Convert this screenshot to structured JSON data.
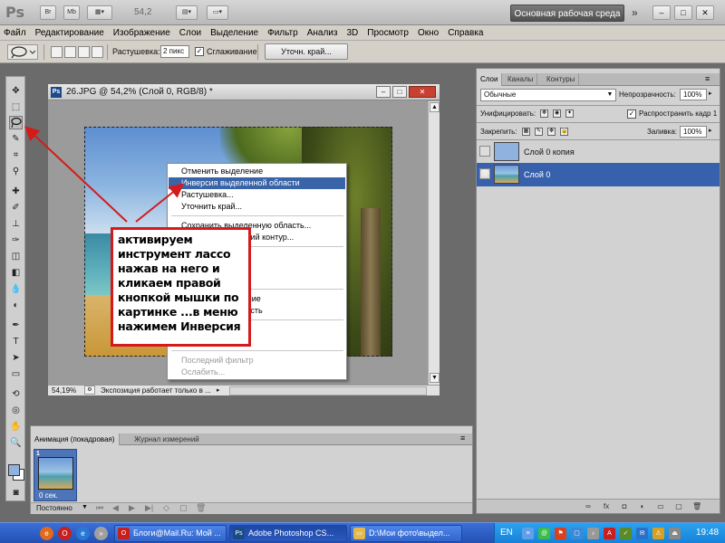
{
  "appbar": {
    "logo": "Ps",
    "btn_br": "Br",
    "btn_mb": "Mb",
    "zoom": "54,2",
    "workspace": "Основная рабочая среда",
    "chevron": "»",
    "minimize": "–",
    "maximize": "□",
    "close": "✕"
  },
  "menu": [
    "Файл",
    "Редактирование",
    "Изображение",
    "Слои",
    "Выделение",
    "Фильтр",
    "Анализ",
    "3D",
    "Просмотр",
    "Окно",
    "Справка"
  ],
  "options": {
    "feather_label": "Растушевка:",
    "feather_value": "2 пикс",
    "antialias_label": "Сглаживание",
    "refine_button": "Уточн. край..."
  },
  "document": {
    "title": "26.JPG @ 54,2% (Слой 0, RGB/8) *",
    "ps_badge": "Ps",
    "zoom_status": "54,19%",
    "status_text": "Экспозиция работает только в ...",
    "scroll_up": "▲",
    "scroll_down": "▼"
  },
  "context_menu": {
    "items": [
      {
        "label": "Отменить выделение"
      },
      {
        "label": "Инверсия выделенной области"
      },
      {
        "label": "Растушевка..."
      },
      {
        "label": "Уточнить край..."
      },
      {
        "label": "Сохранить выделенную область..."
      },
      {
        "label": "Образовать рабочий контур..."
      },
      {
        "label": "Новый слой"
      },
      {
        "label": "Слой"
      },
      {
        "label": "Трансформирование"
      },
      {
        "label": "Выделенную область"
      },
      {
        "label": "..."
      },
      {
        "label": "..."
      },
      {
        "label": "Последний фильтр"
      },
      {
        "label": "Ослабить..."
      }
    ]
  },
  "annotation": {
    "text": "активируем инструмент  лассо нажав на него и кликаем правой кнопкой мышки по картинке ...в меню нажимем Инверсия",
    "color": "#d41b1b"
  },
  "layers_panel": {
    "tabs": [
      "Слои",
      "Каналы",
      "Контуры"
    ],
    "blend_mode": "Обычные",
    "opacity_label": "Непрозрачность:",
    "opacity_value": "100%",
    "unify_label": "Унифицировать:",
    "propagate_label": "Распространить кадр 1",
    "lock_label": "Закрепить:",
    "fill_label": "Заливка:",
    "fill_value": "100%",
    "layers": [
      {
        "name": "Слой 0 копия",
        "selected": false
      },
      {
        "name": "Слой 0",
        "selected": true
      }
    ],
    "footer_icons": [
      "link-icon",
      "fx-icon",
      "mask-icon",
      "adjustment-icon",
      "folder-icon",
      "new-layer-icon",
      "trash-icon"
    ]
  },
  "animation_panel": {
    "tabs": [
      "Анимация (покадровая)",
      "Журнал измерений"
    ],
    "frame_number": "1",
    "frame_delay": "0 сек.",
    "loop": "Постоянно"
  },
  "taskbar": {
    "tasks": [
      {
        "label": "Блоги@Mail.Ru: Мой ..."
      },
      {
        "label": "Adobe Photoshop CS..."
      },
      {
        "label": "D:\\Мои фото\\выдел..."
      }
    ],
    "language": "EN",
    "clock": "19:48"
  }
}
